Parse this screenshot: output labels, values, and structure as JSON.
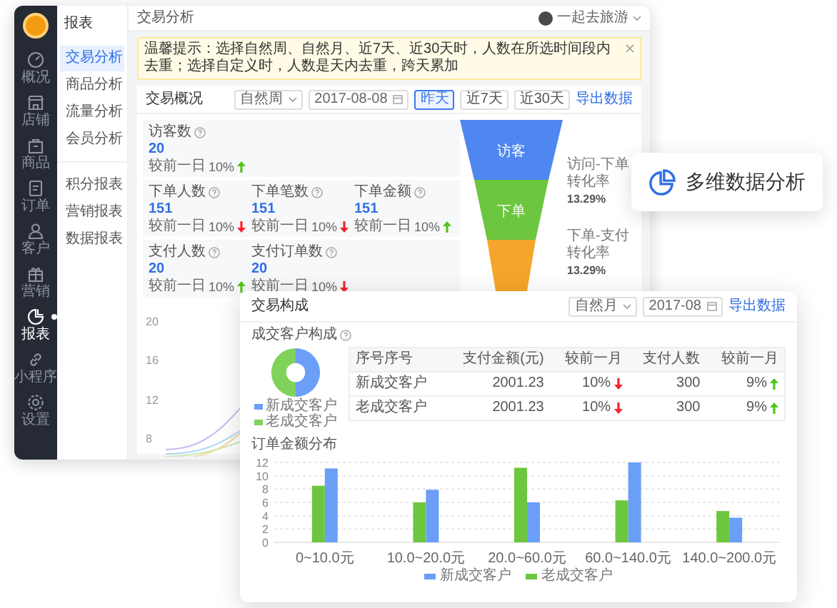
{
  "admin_window": {
    "sidebar": {
      "items": [
        {
          "label": "概况",
          "selected": false
        },
        {
          "label": "店铺",
          "selected": false
        },
        {
          "label": "商品",
          "selected": false
        },
        {
          "label": "订单",
          "selected": false
        },
        {
          "label": "客户",
          "selected": false
        },
        {
          "label": "营销",
          "selected": false
        },
        {
          "label": "报表",
          "selected": true
        },
        {
          "label": "小程序",
          "selected": false
        },
        {
          "label": "设置",
          "selected": false
        }
      ]
    },
    "submenu": {
      "title": "报表",
      "groups": [
        [
          {
            "label": "交易分析",
            "selected": true
          },
          {
            "label": "商品分析",
            "selected": false
          },
          {
            "label": "流量分析",
            "selected": false
          },
          {
            "label": "会员分析",
            "selected": false
          }
        ],
        [
          {
            "label": "积分报表",
            "selected": false
          },
          {
            "label": "营销报表",
            "selected": false
          },
          {
            "label": "数据报表",
            "selected": false
          }
        ]
      ]
    },
    "header": {
      "title": "交易分析",
      "user": "一起去旅游"
    },
    "notice": "温馨提示：选择自然周、自然月、近7天、近30天时，人数在所选时间段内去重；选择自定义时，人数是天内去重，跨天累加",
    "overview": {
      "title": "交易概况",
      "period": "自然周",
      "date": "2017-08-08",
      "export": "导出数据",
      "ranges": [
        {
          "label": "昨天",
          "selected": true
        },
        {
          "label": "近7天",
          "selected": false
        },
        {
          "label": "近30天",
          "selected": false
        }
      ],
      "metric_rows": [
        [
          {
            "label": "访客数",
            "value": "20",
            "compare_label": "较前一日",
            "change": "10%",
            "rising": true
          }
        ],
        [
          {
            "label": "下单人数",
            "value": "151",
            "compare_label": "较前一日",
            "change": "10%",
            "rising": false
          },
          {
            "label": "下单笔数",
            "value": "151",
            "compare_label": "较前一日",
            "change": "10%",
            "rising": false
          },
          {
            "label": "下单金额",
            "value": "151",
            "compare_label": "较前一日",
            "change": "10%",
            "rising": true
          }
        ],
        [
          {
            "label": "支付人数",
            "value": "20",
            "compare_label": "较前一日",
            "change": "10%",
            "rising": true
          },
          {
            "label": "支付订单数",
            "value": "20",
            "compare_label": "较前一日",
            "change": "10%",
            "rising": false
          }
        ]
      ],
      "funnel": [
        {
          "label": "访客",
          "color": "#4f86ef"
        },
        {
          "label": "下单",
          "color": "#6cc63f"
        },
        {
          "color": "#f5a52a"
        }
      ],
      "conversions": [
        {
          "label": "访问-下单转化率",
          "value": "13.29%"
        },
        {
          "label": "下单-支付转化率",
          "value": "13.29%"
        }
      ],
      "trend_chart": {
        "yticks": [
          "20",
          "16",
          "12",
          "8"
        ]
      }
    }
  },
  "composition_card": {
    "title": "交易构成",
    "period": "自然月",
    "date": "2017-08",
    "export": "导出数据",
    "customer_section": {
      "title": "成交客户构成",
      "legend": [
        {
          "label": "新成交客户",
          "color": "#6a9ef7"
        },
        {
          "label": "老成交客户",
          "color": "#7fd35a"
        }
      ],
      "table": {
        "columns": [
          "序号序号",
          "支付金额(元)",
          "较前一月",
          "支付人数",
          "较前一月"
        ],
        "rows": [
          {
            "type": "新成交客户",
            "amount": "2001.23",
            "amount_change": "10%",
            "amount_rising": false,
            "buyers": "300",
            "buyers_change": "9%",
            "buyers_rising": true
          },
          {
            "type": "老成交客户",
            "amount": "2001.23",
            "amount_change": "10%",
            "amount_rising": false,
            "buyers": "300",
            "buyers_change": "9%",
            "buyers_rising": true
          }
        ]
      }
    },
    "bar_chart": {
      "chart_data": {
        "type": "bar",
        "title": "订单金额分布",
        "categories": [
          "0~10.0元",
          "10.0~20.0元",
          "20.0~60.0元",
          "60.0~140.0元",
          "140.0~200.0元"
        ],
        "series": [
          {
            "name": "新成交客户",
            "color": "#6a9ef7",
            "values": [
              11.1,
              7.9,
              6,
              12,
              3.7
            ]
          },
          {
            "name": "老成交客户",
            "color": "#6cc63f",
            "values": [
              8.5,
              6,
              11.2,
              6.3,
              4.7
            ]
          }
        ],
        "ylim": [
          0,
          12
        ],
        "yticks": [
          0,
          2,
          4,
          6,
          8,
          10,
          12
        ],
        "grid": true
      }
    }
  },
  "feature_badge": {
    "label": "多维数据分析"
  }
}
